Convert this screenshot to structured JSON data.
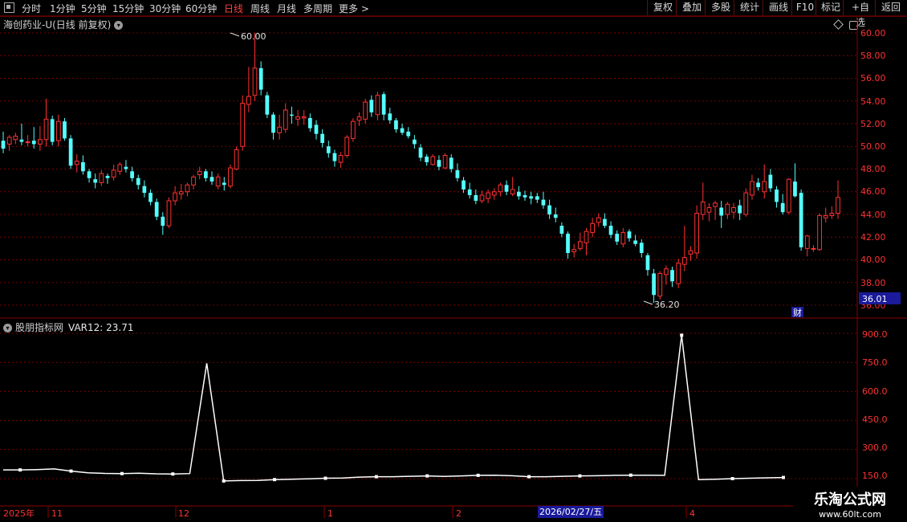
{
  "toolbar": {
    "periods": [
      "分时",
      "1分钟",
      "5分钟",
      "15分钟",
      "30分钟",
      "60分钟",
      "日线",
      "周线",
      "月线",
      "多周期",
      "更多 >"
    ],
    "active_period": "日线",
    "tools": [
      "复权",
      "叠加",
      "多股",
      "统计",
      "画线",
      "F10",
      "标记",
      "+自选",
      "返回"
    ]
  },
  "stock": {
    "name": "海创药业-U",
    "mode": "(日线 前复权)"
  },
  "price_axis": {
    "ticks": [
      "60.00",
      "58.00",
      "56.00",
      "54.00",
      "52.00",
      "50.00",
      "48.00",
      "46.00",
      "44.00",
      "42.00",
      "40.00",
      "38.00",
      "36.00"
    ],
    "current_label": "36.01"
  },
  "annotations": {
    "high_label": "60.00",
    "low_label": "36.20",
    "cai": "财"
  },
  "indicator": {
    "source": "股朋指标网",
    "var_label": "VAR12: 23.71",
    "ticks": [
      "900.0",
      "750.0",
      "600.0",
      "450.0",
      "300.0",
      "150.0"
    ]
  },
  "date_axis": {
    "labels": [
      "2025年",
      "11",
      "12",
      "1",
      "2",
      "4"
    ],
    "cursor_date": "2026/02/27/五"
  },
  "watermark": {
    "line1": "乐淘公式网",
    "line2": "www.60lt.com"
  },
  "colors": {
    "up": "#ff3232",
    "down": "#54ffff",
    "grid": "#7a0000",
    "line": "#ffffff",
    "cursor_bg": "#1a1a9a"
  },
  "chart_data": {
    "type": "candlestick",
    "ylim": [
      36,
      61
    ],
    "candles": [
      [
        50.5,
        51.3,
        49.4,
        49.8
      ],
      [
        50.2,
        51.0,
        49.6,
        50.8
      ],
      [
        50.6,
        51.2,
        50.2,
        50.9
      ],
      [
        50.6,
        52.0,
        50.1,
        50.4
      ],
      [
        50.4,
        51.0,
        50.0,
        50.4
      ],
      [
        50.5,
        51.7,
        49.8,
        50.2
      ],
      [
        50.2,
        51.8,
        49.6,
        50.6
      ],
      [
        50.6,
        54.2,
        50.0,
        52.4
      ],
      [
        52.4,
        52.7,
        50.1,
        50.4
      ],
      [
        50.5,
        52.8,
        50.0,
        52.2
      ],
      [
        52.2,
        52.5,
        50.5,
        50.7
      ],
      [
        50.7,
        51.0,
        48.0,
        48.3
      ],
      [
        48.4,
        49.3,
        47.7,
        48.7
      ],
      [
        48.6,
        49.2,
        47.5,
        47.8
      ],
      [
        47.8,
        48.0,
        46.8,
        47.2
      ],
      [
        47.1,
        47.6,
        46.3,
        46.8
      ],
      [
        46.8,
        47.9,
        46.5,
        47.6
      ],
      [
        47.4,
        47.6,
        46.7,
        47.2
      ],
      [
        47.3,
        48.4,
        47.0,
        47.9
      ],
      [
        47.8,
        48.6,
        47.5,
        48.4
      ],
      [
        48.2,
        48.8,
        47.7,
        48.0
      ],
      [
        47.8,
        48.2,
        46.9,
        47.2
      ],
      [
        47.2,
        47.5,
        46.2,
        46.6
      ],
      [
        46.5,
        47.0,
        45.5,
        45.9
      ],
      [
        45.9,
        46.2,
        44.8,
        45.1
      ],
      [
        45.1,
        45.4,
        43.5,
        43.8
      ],
      [
        43.8,
        44.2,
        42.2,
        43.0
      ],
      [
        43.0,
        45.5,
        42.8,
        45.2
      ],
      [
        45.2,
        46.5,
        44.8,
        45.9
      ],
      [
        45.8,
        46.7,
        45.3,
        46.0
      ],
      [
        46.0,
        46.8,
        45.6,
        46.6
      ],
      [
        46.6,
        47.5,
        46.2,
        47.3
      ],
      [
        47.5,
        48.2,
        47.1,
        47.8
      ],
      [
        47.8,
        48.0,
        46.9,
        47.2
      ],
      [
        47.3,
        47.8,
        46.6,
        46.9
      ],
      [
        46.5,
        47.6,
        46.2,
        47.3
      ],
      [
        46.8,
        47.3,
        46.1,
        46.6
      ],
      [
        46.5,
        48.4,
        46.3,
        48.1
      ],
      [
        48.0,
        50.0,
        47.9,
        49.7
      ],
      [
        50.0,
        54.5,
        49.6,
        53.8
      ],
      [
        53.7,
        57.0,
        53.0,
        54.4
      ],
      [
        54.5,
        60.0,
        54.0,
        56.9
      ],
      [
        56.9,
        57.5,
        54.5,
        55.0
      ],
      [
        54.5,
        54.8,
        52.5,
        52.8
      ],
      [
        52.8,
        53.0,
        50.6,
        51.2
      ],
      [
        51.2,
        52.8,
        50.6,
        51.7
      ],
      [
        51.5,
        53.8,
        51.2,
        53.2
      ],
      [
        52.8,
        53.5,
        52.0,
        52.7
      ],
      [
        52.4,
        53.2,
        51.8,
        52.6
      ],
      [
        52.5,
        53.2,
        51.9,
        52.6
      ],
      [
        52.5,
        52.9,
        51.3,
        51.6
      ],
      [
        51.9,
        52.3,
        50.6,
        51.1
      ],
      [
        51.1,
        51.5,
        49.9,
        50.3
      ],
      [
        50.0,
        50.5,
        49.0,
        49.4
      ],
      [
        49.4,
        49.7,
        48.2,
        48.7
      ],
      [
        48.6,
        49.5,
        48.1,
        49.2
      ],
      [
        49.2,
        51.0,
        49.0,
        50.8
      ],
      [
        50.7,
        52.5,
        50.4,
        52.2
      ],
      [
        52.3,
        53.0,
        51.8,
        52.6
      ],
      [
        52.4,
        54.2,
        52.0,
        53.9
      ],
      [
        54.1,
        54.5,
        52.6,
        53.0
      ],
      [
        52.8,
        54.8,
        52.3,
        54.5
      ],
      [
        54.6,
        54.8,
        52.3,
        52.8
      ],
      [
        52.9,
        53.4,
        52.0,
        52.3
      ],
      [
        52.3,
        52.5,
        51.2,
        51.5
      ],
      [
        51.6,
        52.0,
        51.0,
        51.2
      ],
      [
        51.3,
        51.7,
        50.7,
        50.9
      ],
      [
        50.6,
        51.0,
        49.8,
        50.2
      ],
      [
        49.9,
        50.2,
        48.7,
        49.0
      ],
      [
        49.1,
        49.3,
        48.3,
        48.6
      ],
      [
        48.4,
        49.3,
        48.3,
        49.1
      ],
      [
        48.8,
        49.2,
        47.9,
        48.2
      ],
      [
        48.1,
        49.4,
        48.0,
        49.2
      ],
      [
        49.0,
        49.3,
        47.7,
        48.0
      ],
      [
        47.9,
        48.5,
        46.9,
        47.2
      ],
      [
        47.0,
        47.3,
        45.9,
        46.2
      ],
      [
        46.2,
        46.8,
        45.4,
        45.7
      ],
      [
        45.7,
        46.2,
        44.9,
        45.2
      ],
      [
        45.2,
        46.1,
        45.0,
        45.7
      ],
      [
        45.4,
        46.2,
        45.0,
        45.9
      ],
      [
        45.7,
        46.3,
        45.3,
        46.0
      ],
      [
        46.0,
        46.8,
        45.6,
        46.6
      ],
      [
        46.6,
        47.0,
        45.7,
        46.0
      ],
      [
        45.8,
        47.3,
        45.6,
        46.2
      ],
      [
        46.0,
        46.5,
        45.3,
        45.6
      ],
      [
        45.7,
        46.1,
        45.2,
        45.5
      ],
      [
        45.6,
        46.0,
        44.9,
        45.4
      ],
      [
        45.6,
        45.9,
        45.0,
        45.3
      ],
      [
        45.3,
        46.0,
        44.5,
        44.8
      ],
      [
        44.8,
        45.3,
        43.6,
        44.0
      ],
      [
        44.0,
        44.6,
        43.3,
        43.7
      ],
      [
        43.0,
        43.3,
        42.0,
        42.3
      ],
      [
        42.3,
        42.5,
        40.1,
        40.6
      ],
      [
        40.7,
        41.4,
        40.2,
        40.9
      ],
      [
        41.0,
        42.4,
        40.8,
        41.6
      ],
      [
        41.5,
        42.8,
        40.4,
        42.5
      ],
      [
        42.4,
        43.7,
        42.0,
        43.2
      ],
      [
        43.3,
        44.1,
        42.9,
        43.7
      ],
      [
        43.6,
        44.1,
        42.8,
        43.0
      ],
      [
        43.0,
        43.4,
        41.9,
        42.2
      ],
      [
        42.3,
        42.6,
        41.3,
        41.6
      ],
      [
        41.4,
        42.8,
        41.1,
        42.4
      ],
      [
        42.5,
        42.7,
        41.6,
        41.9
      ],
      [
        41.7,
        42.2,
        41.2,
        41.4
      ],
      [
        41.5,
        41.8,
        40.2,
        40.6
      ],
      [
        40.4,
        40.6,
        38.6,
        39.1
      ],
      [
        38.8,
        39.2,
        36.2,
        36.9
      ],
      [
        36.8,
        39.0,
        36.5,
        38.8
      ],
      [
        38.7,
        39.5,
        37.8,
        39.2
      ],
      [
        39.1,
        39.4,
        37.6,
        38.1
      ],
      [
        37.9,
        40.1,
        37.5,
        39.7
      ],
      [
        39.6,
        43.0,
        39.0,
        40.2
      ],
      [
        40.5,
        41.2,
        39.9,
        40.8
      ],
      [
        40.6,
        44.8,
        40.1,
        44.1
      ],
      [
        44.0,
        46.8,
        43.5,
        45.1
      ],
      [
        44.2,
        45.0,
        43.4,
        44.6
      ],
      [
        44.7,
        45.2,
        43.5,
        45.0
      ],
      [
        44.6,
        45.2,
        42.8,
        43.9
      ],
      [
        44.0,
        45.1,
        43.6,
        44.9
      ],
      [
        44.2,
        45.0,
        43.6,
        44.6
      ],
      [
        44.8,
        45.3,
        43.5,
        44.1
      ],
      [
        44.0,
        46.3,
        43.8,
        45.9
      ],
      [
        45.7,
        47.5,
        45.3,
        46.9
      ],
      [
        46.8,
        47.2,
        46.1,
        46.4
      ],
      [
        46.0,
        48.4,
        45.4,
        46.9
      ],
      [
        47.5,
        48.0,
        46.0,
        46.3
      ],
      [
        46.2,
        46.5,
        44.6,
        45.1
      ],
      [
        45.0,
        45.8,
        44.0,
        44.2
      ],
      [
        44.2,
        47.2,
        44.0,
        47.1
      ],
      [
        46.9,
        48.5,
        45.5,
        45.6
      ],
      [
        45.9,
        46.2,
        40.8,
        41.1
      ],
      [
        41.0,
        42.2,
        40.3,
        42.1
      ],
      [
        41.0,
        41.3,
        40.7,
        41.0
      ],
      [
        40.9,
        44.1,
        40.8,
        43.9
      ],
      [
        43.7,
        44.6,
        43.3,
        43.9
      ],
      [
        43.9,
        44.7,
        43.6,
        44.1
      ],
      [
        44.1,
        47.0,
        43.6,
        45.5
      ]
    ],
    "high": 60.0,
    "low": 36.2,
    "indicator_series": {
      "name": "VAR12",
      "ylim": [
        120,
        960
      ],
      "values": [
        195,
        195,
        197,
        200,
        189,
        180,
        177,
        176,
        178,
        175,
        174,
        176,
        745,
        138,
        140,
        141,
        145,
        147,
        149,
        152,
        153,
        158,
        160,
        160,
        162,
        164,
        161,
        164,
        167,
        168,
        165,
        160,
        160,
        162,
        164,
        165,
        167,
        168,
        168,
        167,
        890,
        145,
        147,
        150,
        152,
        154,
        156
      ]
    }
  }
}
